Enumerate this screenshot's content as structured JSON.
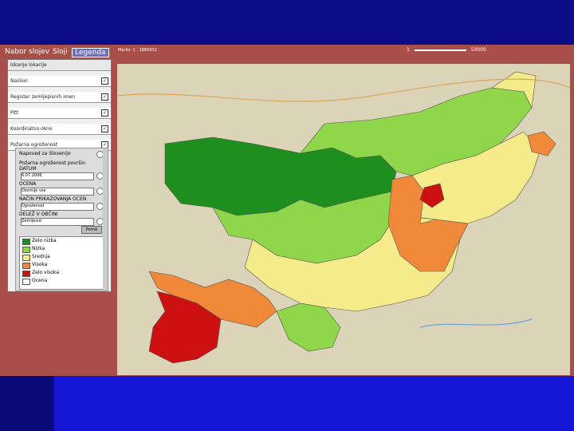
{
  "toolbar": {
    "tab_layers": "Nabor slojev",
    "tab_layers2": "Sloji",
    "tab_legend": "Legenda",
    "scale_left": "Merilo: 1 : 1865632",
    "scale_mid": "1",
    "scale_right": "50000"
  },
  "panel": {
    "rows": [
      {
        "label": "Iskanje lokacije"
      },
      {
        "label": "Naslovi"
      },
      {
        "label": "Register zemljepisnih imen"
      },
      {
        "label": "Pitt"
      },
      {
        "label": "Koordinatno okno"
      },
      {
        "label": "Požarna ogroženost"
      }
    ],
    "sub": {
      "heading": "Napoved za Slovenijo",
      "title": "Požarna ogroženost površin",
      "date_label": "DATUM",
      "date_value": "6.07.2006",
      "region_label": "OCENA",
      "region_value": "Ozemlje vse",
      "method_label": "NAČIN PRIKAZOVANJA OCEN",
      "method_value": "Ogroženost",
      "level_label": "DELEŽ V OBČINI",
      "level_value": "Zemljevid",
      "button": "Potrdi"
    },
    "legend": [
      {
        "label": "Zelo nizka",
        "color": "#1e8f1e"
      },
      {
        "label": "Nizka",
        "color": "#8fd64a"
      },
      {
        "label": "Srednja",
        "color": "#f6eb8a"
      },
      {
        "label": "Visoka",
        "color": "#f08a3a"
      },
      {
        "label": "Zelo visoka",
        "color": "#cc1010"
      },
      {
        "label": "Ocena",
        "color": "#ffffff"
      }
    ]
  },
  "map": {
    "colors": {
      "very_low": "#1e8f1e",
      "low": "#8fd64a",
      "medium": "#f6eb8a",
      "high": "#f08a3a",
      "very_high": "#cc1010",
      "background": "#dcd4b8"
    }
  }
}
